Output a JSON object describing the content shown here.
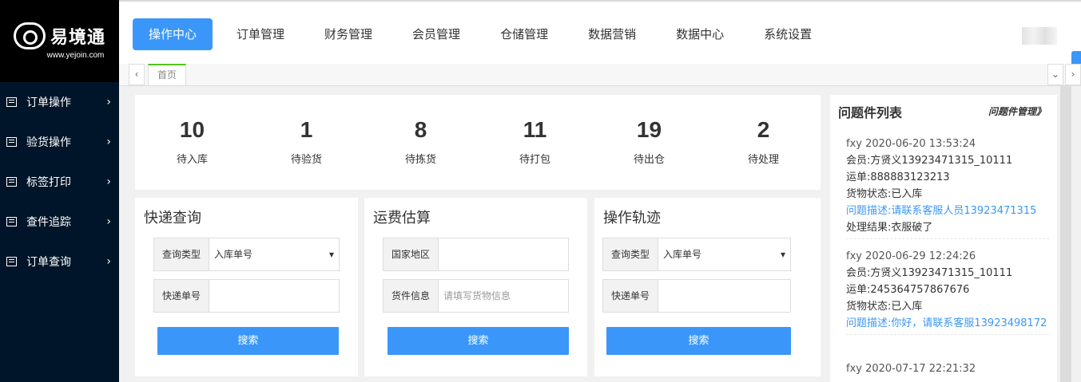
{
  "brand": {
    "name": "易境通",
    "url": "www.yejoin.com"
  },
  "sidebar": {
    "items": [
      {
        "label": "订单操作"
      },
      {
        "label": "验货操作"
      },
      {
        "label": "标签打印"
      },
      {
        "label": "查件追踪"
      },
      {
        "label": "订单查询"
      }
    ]
  },
  "top_menu": {
    "items": [
      {
        "label": "操作中心",
        "active": true
      },
      {
        "label": "订单管理"
      },
      {
        "label": "财务管理"
      },
      {
        "label": "会员管理"
      },
      {
        "label": "仓储管理"
      },
      {
        "label": "数据营销"
      },
      {
        "label": "数据中心"
      },
      {
        "label": "系统设置"
      }
    ]
  },
  "tabs": {
    "prev": "‹",
    "home": "首页",
    "more": "⌄",
    "next": "›"
  },
  "stats": [
    {
      "value": "10",
      "label": "待入库"
    },
    {
      "value": "1",
      "label": "待验货"
    },
    {
      "value": "8",
      "label": "待拣货"
    },
    {
      "value": "11",
      "label": "待打包"
    },
    {
      "value": "19",
      "label": "待出仓"
    },
    {
      "value": "2",
      "label": "待处理"
    }
  ],
  "express_query": {
    "title": "快递查询",
    "type_label": "查询类型",
    "type_value": "入库单号",
    "no_label": "快递单号",
    "search": "搜索"
  },
  "freight": {
    "title": "运费估算",
    "country_label": "国家地区",
    "goods_label": "货件信息",
    "goods_placeholder": "请填写货物信息",
    "search": "搜索"
  },
  "track": {
    "title": "操作轨迹",
    "type_label": "查询类型",
    "type_value": "入库单号",
    "no_label": "快递单号",
    "search": "搜索"
  },
  "issues": {
    "title": "问题件列表",
    "manage": "问题件管理》",
    "items": [
      {
        "header": "fxy   2020-06-20 13:53:24",
        "member": "会员:方贤义13923471315_10111",
        "waybill": "运单:888883123213",
        "status": "货物状态:已入库",
        "desc": "问题描述:请联系客服人员13923471315",
        "result": "处理结果:衣服破了"
      },
      {
        "header": "fxy   2020-06-29 12:24:26",
        "member": "会员:方贤义13923471315_10111",
        "waybill": "运单:245364757867676",
        "status": "货物状态:已入库",
        "desc": "问题描述:你好，请联系客服13923498172"
      },
      {
        "header": "fxy   2020-07-17 22:21:32"
      }
    ]
  }
}
